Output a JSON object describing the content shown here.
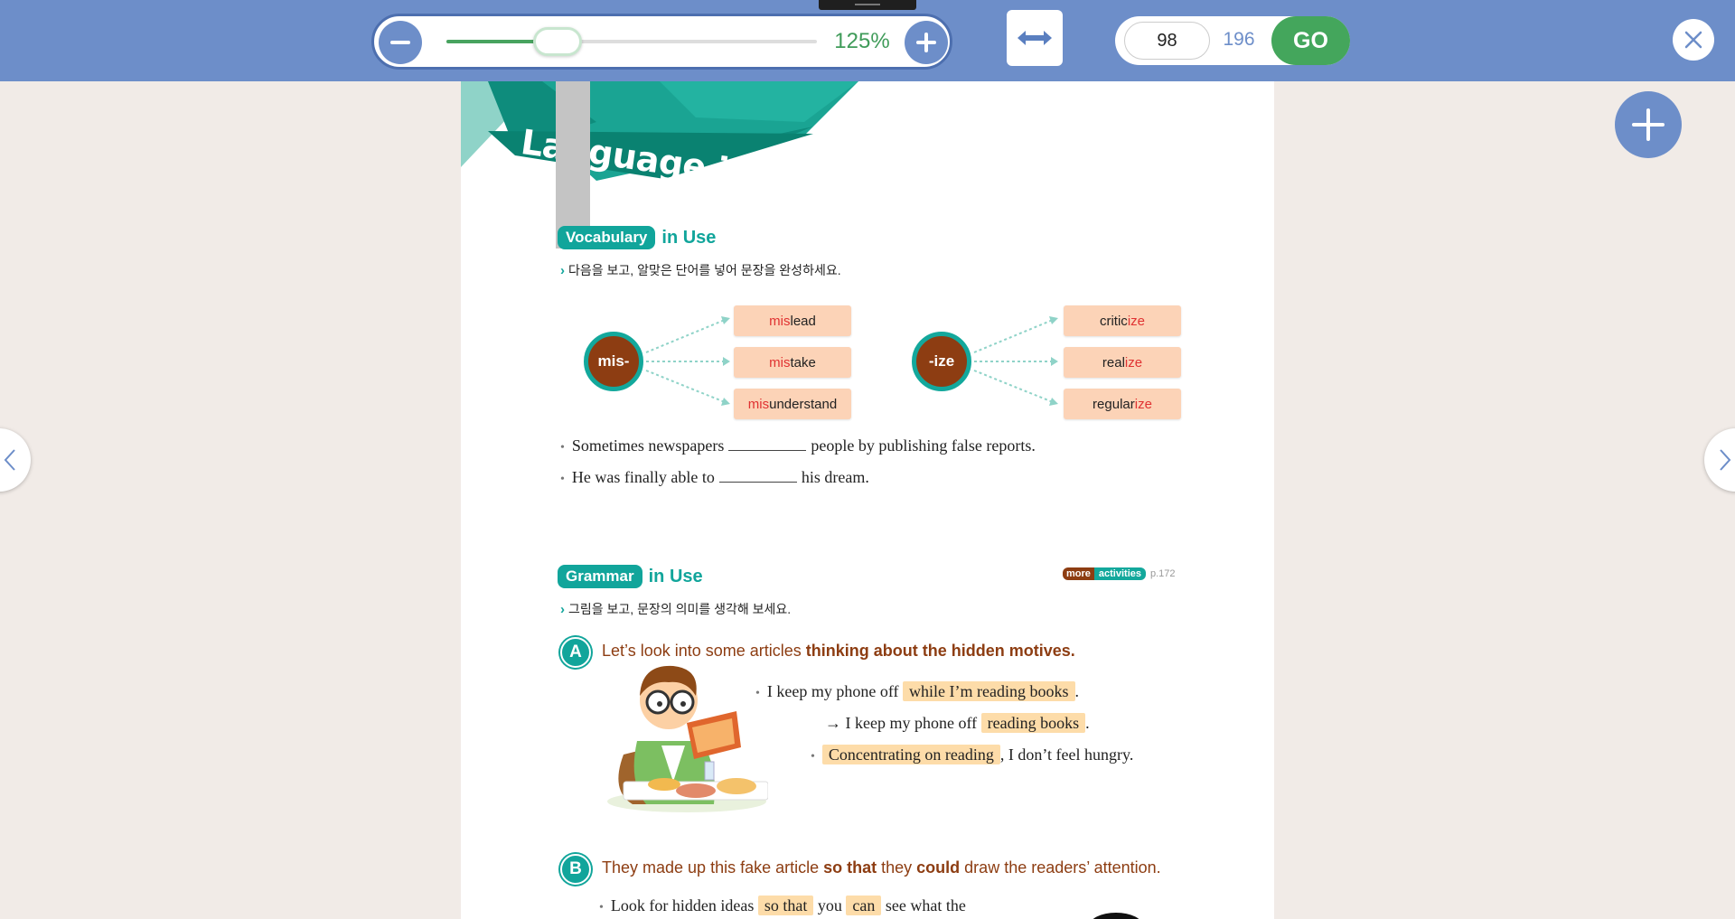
{
  "toolbar": {
    "zoom_label": "125%",
    "zoom_level_fraction": 0.3,
    "page_current": "98",
    "page_total": "196",
    "go_label": "GO"
  },
  "page": {
    "banner_title": "Language in Use",
    "vocab": {
      "pill": "Vocabulary",
      "rest": "in Use",
      "instruction": "다음을 보고, 알맞은 단어를 넣어 문장을 완성하세요.",
      "prefix": "mis-",
      "prefix_words": [
        {
          "colored": "mis",
          "plain": "lead",
          "colored_first": true
        },
        {
          "colored": "mis",
          "plain": "take",
          "colored_first": true
        },
        {
          "colored": "mis",
          "plain": "understand",
          "colored_first": true
        }
      ],
      "suffix": "-ize",
      "suffix_words": [
        {
          "plain": "critic",
          "colored": "ize"
        },
        {
          "plain": "real",
          "colored": "ize"
        },
        {
          "plain": "regular",
          "colored": "ize"
        }
      ],
      "sentence1_a": "Sometimes newspapers",
      "sentence1_b": "people by publishing false reports.",
      "sentence2_a": "He was finally able to",
      "sentence2_b": "his dream."
    },
    "grammar": {
      "pill": "Grammar",
      "rest": "in Use",
      "more_a": "more",
      "more_b": "activities",
      "more_page": "p.172",
      "instruction": "그림을 보고, 문장의 의미를 생각해 보세요.",
      "item_a": {
        "badge": "A",
        "title_plain": "Let’s look into some articles ",
        "title_bold": "thinking about the hidden motives",
        "title_end": ".",
        "line1_a": "I keep my phone off",
        "line1_hl": "while I’m reading books",
        "line1_end": ".",
        "line2_a": "→ I keep my phone off",
        "line2_hl": "reading books",
        "line2_end": ".",
        "line3_hl": "Concentrating on reading",
        "line3_end": ", I don’t feel hungry."
      },
      "item_b": {
        "badge": "B",
        "title_1": "They made up this fake article ",
        "title_2": "so that",
        "title_3": " they ",
        "title_4": "could",
        "title_5": " draw the readers’ attention.",
        "line1_a": "Look for hidden ideas",
        "line1_hl1": "so that",
        "line1_b": "you",
        "line1_hl2": "can",
        "line1_c": "see what the"
      }
    }
  }
}
